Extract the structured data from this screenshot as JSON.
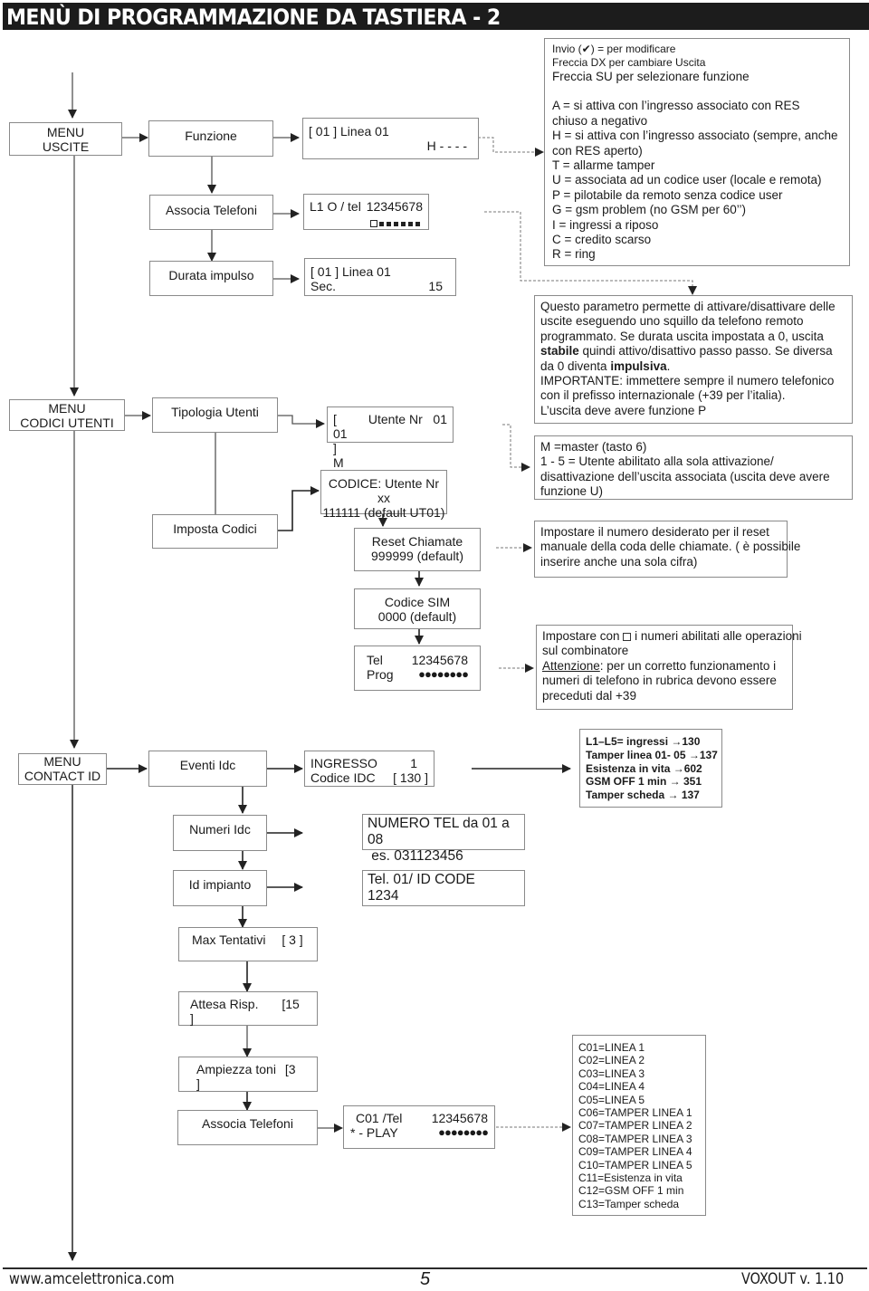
{
  "header": {
    "title": "MENÙ DI PROGRAMMAZIONE DA TASTIERA - 2"
  },
  "menus": {
    "uscite": {
      "line1": "MENU",
      "line2": "USCITE"
    },
    "codici_utenti": {
      "line1": "MENU",
      "line2": "CODICI UTENTI"
    },
    "contact_id": {
      "line1": "MENU",
      "line2": "CONTACT ID"
    }
  },
  "uscite": {
    "funzione": "Funzione",
    "associa_telefoni": "Associa Telefoni",
    "durata_impulso": "Durata impulso",
    "lcd_funzione": {
      "line1": "[ 01 ]  Linea 01",
      "line2": "H - - - -"
    },
    "lcd_telefoni": {
      "left": "L1 O / tel",
      "right": "12345678",
      "slots": 7
    },
    "lcd_durata": {
      "line1": "[ 01 ]  Linea 01",
      "line2_left": "Sec.",
      "line2_right": "15"
    }
  },
  "notes": {
    "legend": {
      "lines_small": [
        "Invio (✔) = per modificare",
        "Freccia DX per cambiare Uscita"
      ],
      "lines": [
        "Freccia SU per selezionare funzione",
        "",
        "A = si attiva con l’ingresso associato con RES",
        "chiuso a negativo",
        "H = si attiva con l’ingresso associato (sempre, anche",
        "con RES aperto)",
        "T = allarme tamper",
        "U = associata ad un codice user (locale e remota)",
        "P = pilotabile da remoto senza codice user",
        "G = gsm problem (no GSM per 60’’)",
        "I = ingressi a riposo",
        "C = credito scarso",
        "R = ring"
      ]
    },
    "parametro": {
      "l1": "Questo parametro permette di attivare/disattivare delle",
      "l2": "uscite eseguendo uno squillo da telefono remoto",
      "l3": "programmato. Se durata uscita impostata a 0, uscita",
      "l4_bold": "stabile",
      "l4_rest": " quindi attivo/disattivo passo passo. Se diversa",
      "l5_pre": "da 0 diventa ",
      "l5_bold": "impulsiva",
      "l5_post": ".",
      "l6": "IMPORTANTE: immettere sempre il numero telefonico",
      "l7": "con il prefisso internazionale (+39 per l’italia).",
      "l8": "L’uscita deve avere funzione P"
    },
    "master": {
      "lines": [
        "M =master (tasto 6)",
        "1 - 5 = Utente abilitato alla sola attivazione/",
        "disattivazione dell’uscita associata (uscita deve avere",
        "funzione U)"
      ]
    },
    "reset": {
      "lines": [
        "Impostare il numero desiderato per il reset",
        "manuale della coda delle chiamate. ( è possibile",
        "inserire anche una sola cifra)"
      ]
    },
    "tel_prog": {
      "l1_pre": "Impostare con",
      "l1_post": " i numeri abilitati alle operazioni",
      "l2": "sul combinatore",
      "l3_ul": "Attenzione",
      "l3_rest": ": per un corretto funzionamento i",
      "l4": "numeri di telefono in rubrica devono essere",
      "l5": "preceduti dal +39"
    },
    "idc_codes": {
      "lines": [
        "L1–L5= ingressi →130",
        "Tamper linea 01- 05  →137",
        "Esistenza in vita →602",
        "GSM OFF 1 min → 351",
        "Tamper scheda → 137"
      ]
    },
    "channels": {
      "lines": [
        "C01=LINEA 1",
        "C02=LINEA 2",
        "C03=LINEA 3",
        "C04=LINEA 4",
        "C05=LINEA 5",
        "C06=TAMPER LINEA 1",
        "C07=TAMPER LINEA 2",
        "C08=TAMPER LINEA 3",
        "C09=TAMPER LINEA 4",
        "C10=TAMPER LINEA 5",
        "C11=Esistenza in vita",
        "C12=GSM OFF 1 min",
        "C13=Tamper scheda"
      ]
    }
  },
  "codici": {
    "tipologia": "Tipologia Utenti",
    "imposta": "Imposta Codici",
    "lcd_utente": {
      "left": "[ 01 ]",
      "right": "Utente Nr   01",
      "line2": "M"
    },
    "codice": {
      "line1": "CODICE: Utente Nr xx",
      "line2": "111111 (default UT01)"
    },
    "reset": {
      "line1": "Reset Chiamate",
      "line2": "999999 (default)"
    },
    "sim": {
      "line1": "Codice SIM",
      "line2": "0000 (default)"
    },
    "tel": {
      "l1_left": "Tel",
      "l1_right": "12345678",
      "l2_left": "Prog",
      "l2_right": "●●●●●●●●"
    }
  },
  "contact": {
    "eventi": "Eventi Idc",
    "numeri": "Numeri Idc",
    "impianto": "Id impianto",
    "max": {
      "label": "Max Tentativi",
      "value": "[ 3 ]"
    },
    "attesa": {
      "label": "Attesa Risp.",
      "value": "[15 ]"
    },
    "ampiezza": {
      "label": "Ampiezza toni",
      "value": "[3 ]"
    },
    "associa": "Associa Telefoni",
    "lcd_ingresso": {
      "l1_left": "INGRESSO",
      "l1_right": "1",
      "l2_left": "Codice IDC",
      "l2_right": "[ 130 ]"
    },
    "lcd_numero": {
      "line1": "NUMERO TEL da 01 a 08",
      "line2": " es. 031123456"
    },
    "lcd_id": {
      "line1": "Tel. 01/ ID CODE",
      "line2": "1234"
    },
    "lcd_associa": {
      "l1_left": "C01 /Tel",
      "l1_right": "12345678",
      "l2_left": "* - PLAY",
      "l2_right": "●●●●●●●●"
    }
  },
  "footer": {
    "website": "www.amcelettronica.com",
    "page": "5",
    "product": "VOXOUT v. 1.10"
  }
}
